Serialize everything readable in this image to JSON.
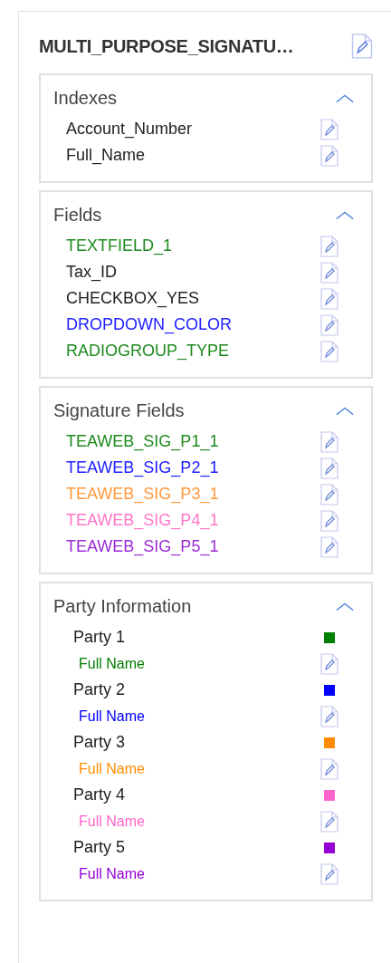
{
  "title": "MULTI_PURPOSE_SIGNATU…",
  "sections": [
    {
      "kind": "list",
      "title": "Indexes",
      "expanded": true,
      "items": [
        {
          "label": "Account_Number",
          "color": "#222222"
        },
        {
          "label": "Full_Name",
          "color": "#222222"
        }
      ]
    },
    {
      "kind": "list",
      "title": "Fields",
      "expanded": true,
      "items": [
        {
          "label": "TEXTFIELD_1",
          "color": "#1e8a1e"
        },
        {
          "label": "Tax_ID",
          "color": "#222222"
        },
        {
          "label": "CHECKBOX_YES",
          "color": "#222222"
        },
        {
          "label": "DROPDOWN_COLOR",
          "color": "#2020ff"
        },
        {
          "label": "RADIOGROUP_TYPE",
          "color": "#1e8a1e"
        }
      ]
    },
    {
      "kind": "list",
      "title": "Signature Fields",
      "expanded": true,
      "items": [
        {
          "label": "TEAWEB_SIG_P1_1",
          "color": "#1e8a1e"
        },
        {
          "label": "TEAWEB_SIG_P2_1",
          "color": "#2020ff"
        },
        {
          "label": "TEAWEB_SIG_P3_1",
          "color": "#ff9a3c"
        },
        {
          "label": "TEAWEB_SIG_P4_1",
          "color": "#ff77c8"
        },
        {
          "label": "TEAWEB_SIG_P5_1",
          "color": "#9a2ad8"
        }
      ]
    },
    {
      "kind": "parties",
      "title": "Party Information",
      "expanded": true,
      "items": [
        {
          "label": "Party 1",
          "field": "Full Name",
          "color": "#008000"
        },
        {
          "label": "Party 2",
          "field": "Full Name",
          "color": "#0000ff"
        },
        {
          "label": "Party 3",
          "field": "Full Name",
          "color": "#ff8c00"
        },
        {
          "label": "Party 4",
          "field": "Full Name",
          "color": "#ff66cc"
        },
        {
          "label": "Party 5",
          "field": "Full Name",
          "color": "#9400d3"
        }
      ]
    }
  ]
}
